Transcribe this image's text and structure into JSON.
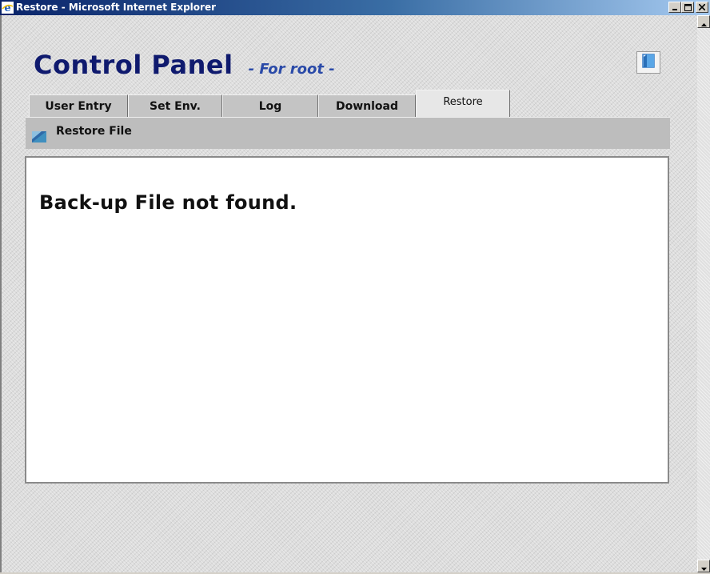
{
  "window": {
    "title": "Restore - Microsoft Internet Explorer",
    "minimize_icon": "minimize-icon",
    "maximize_icon": "maximize-icon",
    "close_icon": "close-icon"
  },
  "header": {
    "title": "Control Panel",
    "subtitle": "- For root -",
    "logout_icon": "logout-door-icon"
  },
  "tabs": [
    {
      "label": "User Entry",
      "active": false
    },
    {
      "label": "Set Env.",
      "active": false
    },
    {
      "label": "Log",
      "active": false
    },
    {
      "label": "Download",
      "active": false
    },
    {
      "label": "Restore",
      "active": true
    }
  ],
  "toolbar": {
    "label": "Restore File",
    "icon": "restore-file-icon"
  },
  "content": {
    "message": "Back-up File not found."
  },
  "colors": {
    "title_blue": "#0f1a6e",
    "subtitle_blue": "#2a4aa8",
    "titlebar_start": "#0a246a",
    "titlebar_end": "#a6caf0"
  }
}
